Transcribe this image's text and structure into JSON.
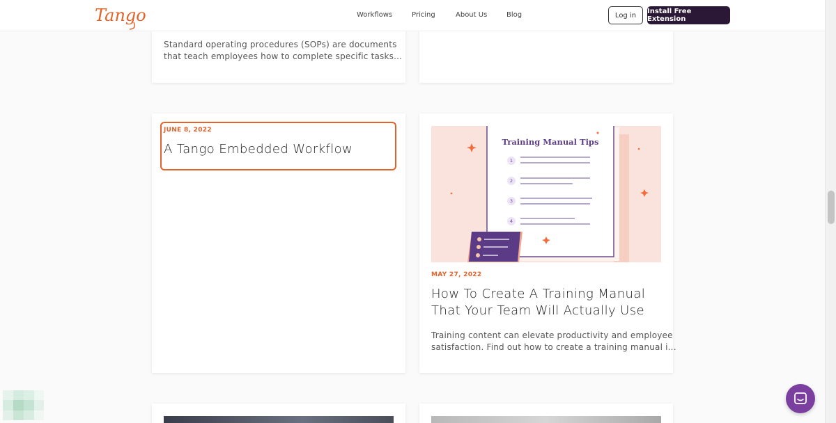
{
  "header": {
    "logo_text": "Tango",
    "nav": [
      "Workflows",
      "Pricing",
      "About Us",
      "Blog"
    ],
    "login_label": "Log in",
    "install_label": "Install Free Extension"
  },
  "cards": {
    "top_left_desc_1": "Standard operating procedures (SOPs) are documents",
    "top_left_desc_2": "that teach employees how to complete specific tasks...",
    "embedded": {
      "date": "JUNE 8, 2022",
      "title": "A Tango Embedded Workflow"
    },
    "training": {
      "image_title": "Training Manual Tips",
      "image_steps": [
        "1",
        "2",
        "3",
        "4"
      ],
      "date": "MAY 27, 2022",
      "title_line1": "How To Create A Training Manual",
      "title_line2": "That Your Team Will Actually Use",
      "desc_1": "Training content can elevate productivity and employee",
      "desc_2": "satisfaction. Find out how to create a training manual i..."
    }
  },
  "colors": {
    "accent": "#e2622a",
    "brand_dark": "#2b1837",
    "chat_purple": "#7b3fa0",
    "image_bg": "#fbe3dd"
  },
  "icons": {
    "chat": "chat-bubble-icon",
    "sparkle": "sparkle-icon"
  }
}
